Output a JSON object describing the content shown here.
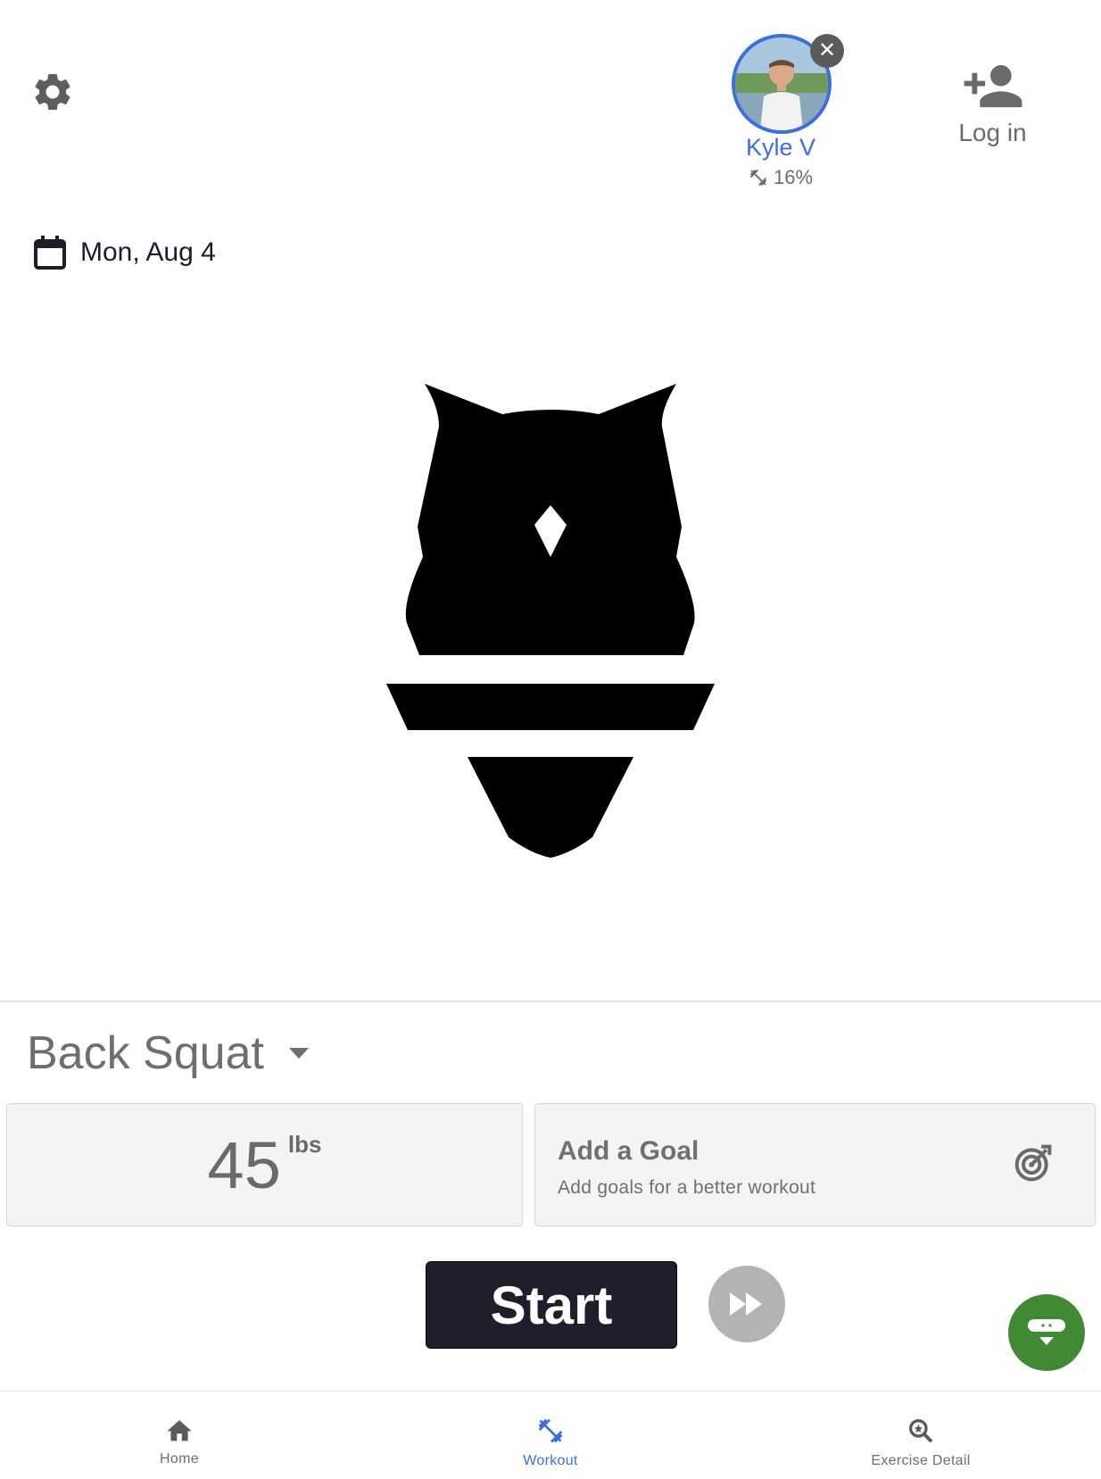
{
  "header": {
    "user": {
      "name": "Kyle V",
      "progress": "16%"
    },
    "login_label": "Log in"
  },
  "date": "Mon, Aug 4",
  "exercise": {
    "name": "Back Squat"
  },
  "weight": {
    "value": "45",
    "unit": "lbs"
  },
  "goal": {
    "title": "Add a Goal",
    "subtitle": "Add goals for a better workout"
  },
  "start_label": "Start",
  "nav": [
    {
      "label": "Home",
      "icon": "home-icon"
    },
    {
      "label": "Workout",
      "icon": "dumbbell-icon",
      "active": true
    },
    {
      "label": "Exercise Detail",
      "icon": "search-icon"
    }
  ],
  "colors": {
    "accent": "#3a6fe3",
    "fab": "#3f8a32",
    "start": "#1e1e2c"
  }
}
